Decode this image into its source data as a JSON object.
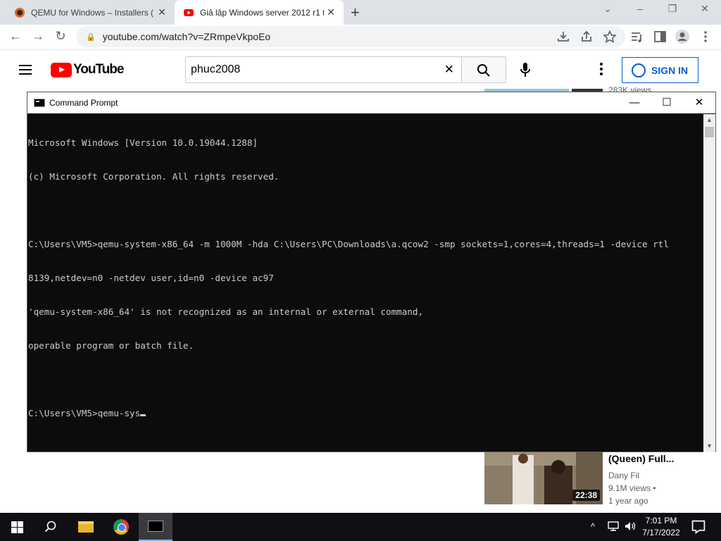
{
  "browser": {
    "tabs": [
      {
        "title": "QEMU for Windows – Installers (",
        "favicon": "qemu-icon"
      },
      {
        "title": "Giả lập Windows server 2012 r1 t",
        "favicon": "youtube-icon",
        "active": true
      }
    ],
    "new_tab_label": "+",
    "window_controls": {
      "minimize": "–",
      "restore": "❐",
      "close": "✕",
      "tablist": "⌄"
    },
    "url": "youtube.com/watch?v=ZRmpeVkpoEo",
    "nav": {
      "back": "←",
      "forward": "→",
      "reload": "↻",
      "lock": "🔒"
    },
    "toolbar_icons": [
      "download-icon",
      "share-icon",
      "bookmark-star-icon",
      "media-control-icon",
      "side-panel-icon",
      "profile-icon",
      "browser-menu-icon"
    ]
  },
  "youtube": {
    "logo_text": "YouTube",
    "search_query": "phuc2008",
    "search_clear": "✕",
    "signin_label": "SIGN IN",
    "peek_text": "283K views",
    "video": {
      "title": "(Queen) Full...",
      "channel": "Dany Fil",
      "views": "9.1M views •",
      "age": "1 year ago",
      "duration": "22:38"
    }
  },
  "cmd": {
    "window_title": "Command Prompt",
    "controls": {
      "minimize": "—",
      "maximize": "☐",
      "close": "✕"
    },
    "lines": [
      "Microsoft Windows [Version 10.0.19044.1288]",
      "(c) Microsoft Corporation. All rights reserved.",
      "",
      "C:\\Users\\VM5>qemu-system-x86_64 -m 1000M -hda C:\\Users\\PC\\Downloads\\a.qcow2 -smp sockets=1,cores=4,threads=1 -device rtl",
      "8139,netdev=n0 -netdev user,id=n0 -device ac97",
      "'qemu-system-x86_64' is not recognized as an internal or external command,",
      "operable program or batch file.",
      "",
      "C:\\Users\\VM5>qemu-sys"
    ],
    "scroll": {
      "up": "▲",
      "down": "▼"
    }
  },
  "taskbar": {
    "apps": [
      "start-button",
      "search",
      "file-explorer",
      "chrome",
      "command-prompt"
    ],
    "tray": {
      "chevron": "^",
      "network": "🖧",
      "volume": "🔊"
    },
    "time": "7:01 PM",
    "date": "7/17/2022",
    "notification": "☐"
  }
}
